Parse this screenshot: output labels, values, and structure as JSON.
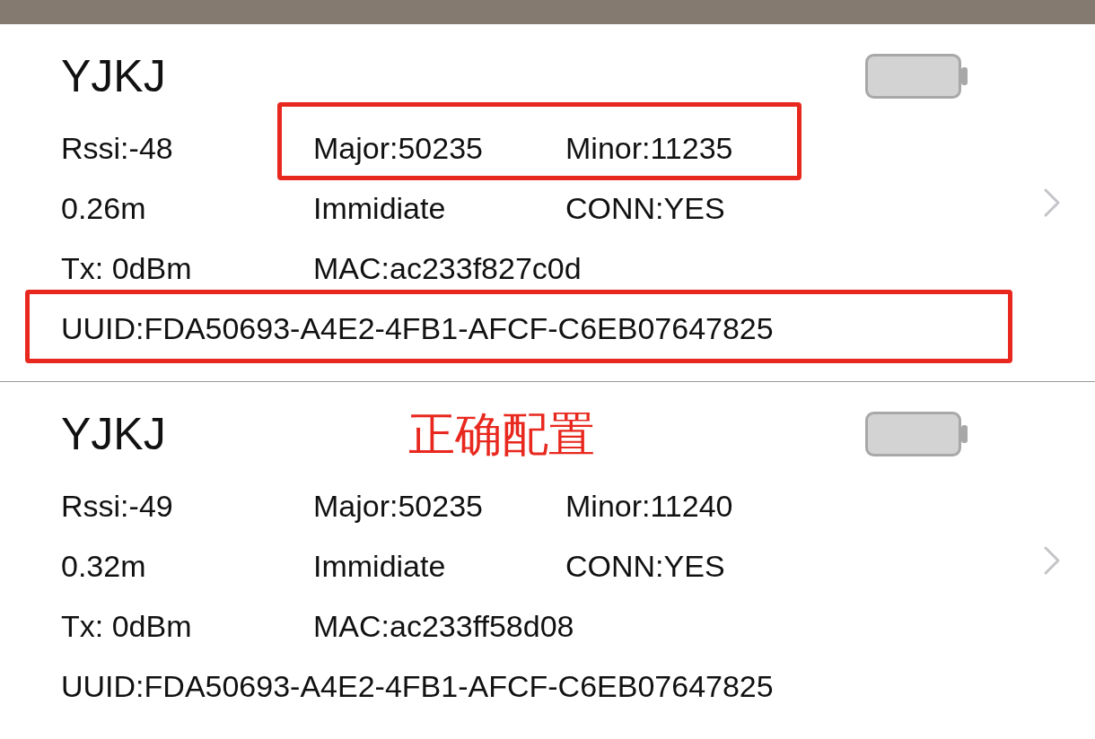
{
  "devices": [
    {
      "name": "YJKJ",
      "rssi": "Rssi:-48",
      "major": "Major:50235",
      "minor": "Minor:11235",
      "distance": "0.26m",
      "proximity": "Immidiate",
      "conn": "CONN:YES",
      "tx": "Tx: 0dBm",
      "mac": "MAC:ac233f827c0d",
      "uuid": "UUID:FDA50693-A4E2-4FB1-AFCF-C6EB07647825",
      "ids_highlighted": true,
      "uuid_highlighted": true
    },
    {
      "name": "YJKJ",
      "note": "正确配置",
      "rssi": "Rssi:-49",
      "major": "Major:50235",
      "minor": "Minor:11240",
      "distance": "0.32m",
      "proximity": "Immidiate",
      "conn": "CONN:YES",
      "tx": "Tx: 0dBm",
      "mac": "MAC:ac233ff58d08",
      "uuid": "UUID:FDA50693-A4E2-4FB1-AFCF-C6EB07647825",
      "ids_highlighted": false,
      "uuid_highlighted": false
    }
  ]
}
